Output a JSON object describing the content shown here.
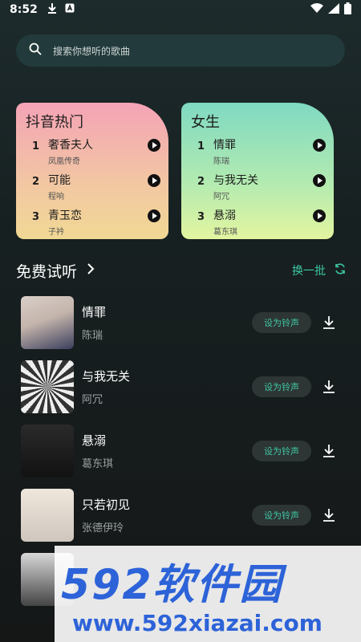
{
  "status_bar": {
    "time": "8:52",
    "icons": [
      "download-icon",
      "a-badge-icon"
    ],
    "right_icons": [
      "wifi-icon",
      "signal-icon",
      "battery-icon"
    ]
  },
  "search": {
    "placeholder": "搜索你想听的歌曲"
  },
  "cards": [
    {
      "title": "抖音热门",
      "songs": [
        {
          "num": "1",
          "name": "奢香夫人",
          "artist": "凤凰传奇"
        },
        {
          "num": "2",
          "name": "可能",
          "artist": "程响"
        },
        {
          "num": "3",
          "name": "青玉恋",
          "artist": "子衿"
        }
      ]
    },
    {
      "title": "女生",
      "songs": [
        {
          "num": "1",
          "name": "情罪",
          "artist": "陈瑞"
        },
        {
          "num": "2",
          "name": "与我无关",
          "artist": "阿冗"
        },
        {
          "num": "3",
          "name": "悬溺",
          "artist": "葛东琪"
        }
      ]
    }
  ],
  "section": {
    "title": "免费试听",
    "refresh_label": "换一批"
  },
  "list": {
    "ringtone_label": "设为铃声",
    "items": [
      {
        "title": "情罪",
        "artist": "陈瑞"
      },
      {
        "title": "与我无关",
        "artist": "阿冗"
      },
      {
        "title": "悬溺",
        "artist": "葛东琪"
      },
      {
        "title": "只若初见",
        "artist": "张德伊玲"
      }
    ]
  },
  "watermark": {
    "logo": "592软件园",
    "url": "www.592xiazai.com"
  },
  "colors": {
    "accent": "#3ec7a4",
    "background": "#172021",
    "watermark": "#2d63d8"
  }
}
